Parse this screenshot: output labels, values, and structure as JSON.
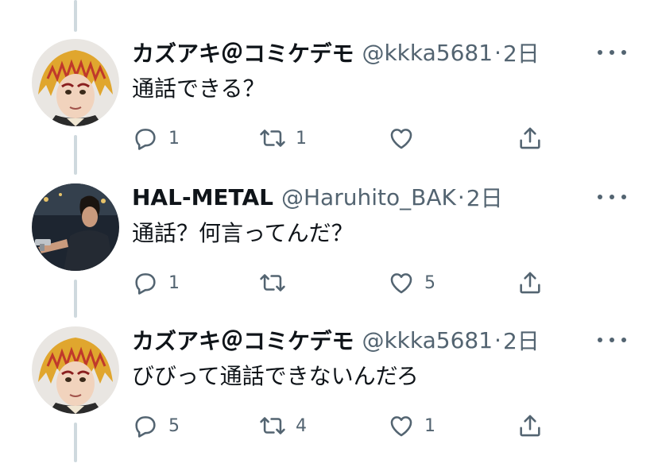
{
  "tweets": [
    {
      "display_name": "カズアキ＠コミケデモ",
      "handle": "@kkka5681",
      "separator": "·",
      "time": "2日",
      "text": "通話できる？",
      "replies": "1",
      "retweets": "1",
      "likes": ""
    },
    {
      "display_name": "HAL-METAL",
      "handle": "@Haruhito_BAK",
      "separator": "·",
      "time": "2日",
      "text": "通話？何言ってんだ？",
      "replies": "1",
      "retweets": "",
      "likes": "5"
    },
    {
      "display_name": "カズアキ＠コミケデモ",
      "handle": "@kkka5681",
      "separator": "·",
      "time": "2日",
      "text": "びびって通話できないんだろ",
      "replies": "5",
      "retweets": "4",
      "likes": "1"
    }
  ],
  "icons": {
    "reply": "reply-icon",
    "retweet": "retweet-icon",
    "like": "heart-icon",
    "share": "share-icon",
    "more": "more-icon"
  },
  "colors": {
    "text": "#0f1419",
    "secondary": "#536471",
    "thread_line": "#cfd9de"
  }
}
